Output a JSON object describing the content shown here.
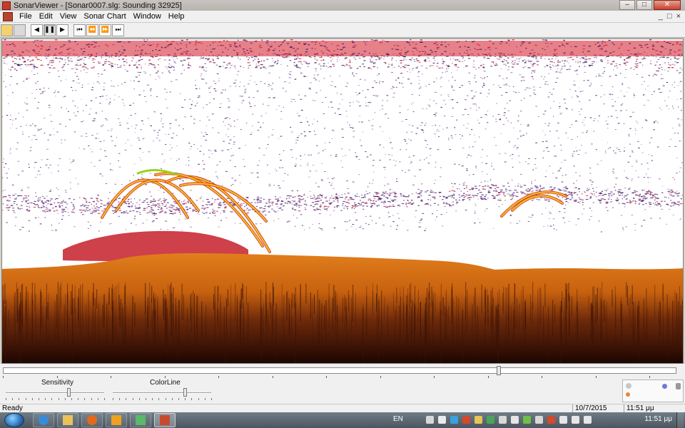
{
  "window": {
    "title": "SonarViewer - [Sonar0007.slg: Sounding 32925]",
    "controls": [
      "–",
      "□",
      "✕"
    ]
  },
  "menu": {
    "items": [
      "File",
      "Edit",
      "View",
      "Sonar Chart",
      "Window",
      "Help"
    ],
    "mdi_controls": [
      "_",
      "□",
      "×"
    ]
  },
  "toolbar": {
    "buttons": [
      {
        "name": "open-icon",
        "glyph": ""
      },
      {
        "name": "print-icon",
        "glyph": ""
      },
      {
        "name": "step-back-icon",
        "glyph": "◀"
      },
      {
        "name": "pause-icon",
        "glyph": "❚❚"
      },
      {
        "name": "play-icon",
        "glyph": "▶"
      },
      {
        "name": "go-start-icon",
        "glyph": "⏮"
      },
      {
        "name": "fast-rewind-icon",
        "glyph": "⏪"
      },
      {
        "name": "fast-forward-icon",
        "glyph": "⏩"
      },
      {
        "name": "go-end-icon",
        "glyph": "⏭"
      }
    ]
  },
  "sonar": {
    "colors": {
      "surface_noise": "#3a1255",
      "surface_band": "#d11a2a",
      "echo_purple": "#4a1a6e",
      "fish_yellow": "#f2c21b",
      "fish_green": "#9ad21a",
      "fish_red": "#d1271a",
      "bottom_orange": "#e17e1c",
      "bottom_dark": "#3a1206",
      "background": "#ffffff"
    }
  },
  "controls": {
    "timeline_position": 0.735,
    "sensitivity_label": "Sensitivity",
    "colorline_label": "ColorLine",
    "sensitivity_value": 0.65,
    "colorline_value": 0.75
  },
  "status": {
    "ready": "Ready",
    "date": "10/7/2015",
    "time": "11:51 μμ"
  },
  "taskbar": {
    "language": "EN",
    "clock": "11:51 μμ",
    "apps": [
      "ie-icon",
      "folder-icon",
      "firefox-icon",
      "media-player-icon",
      "photos-icon",
      "sonarviewer-icon"
    ]
  }
}
